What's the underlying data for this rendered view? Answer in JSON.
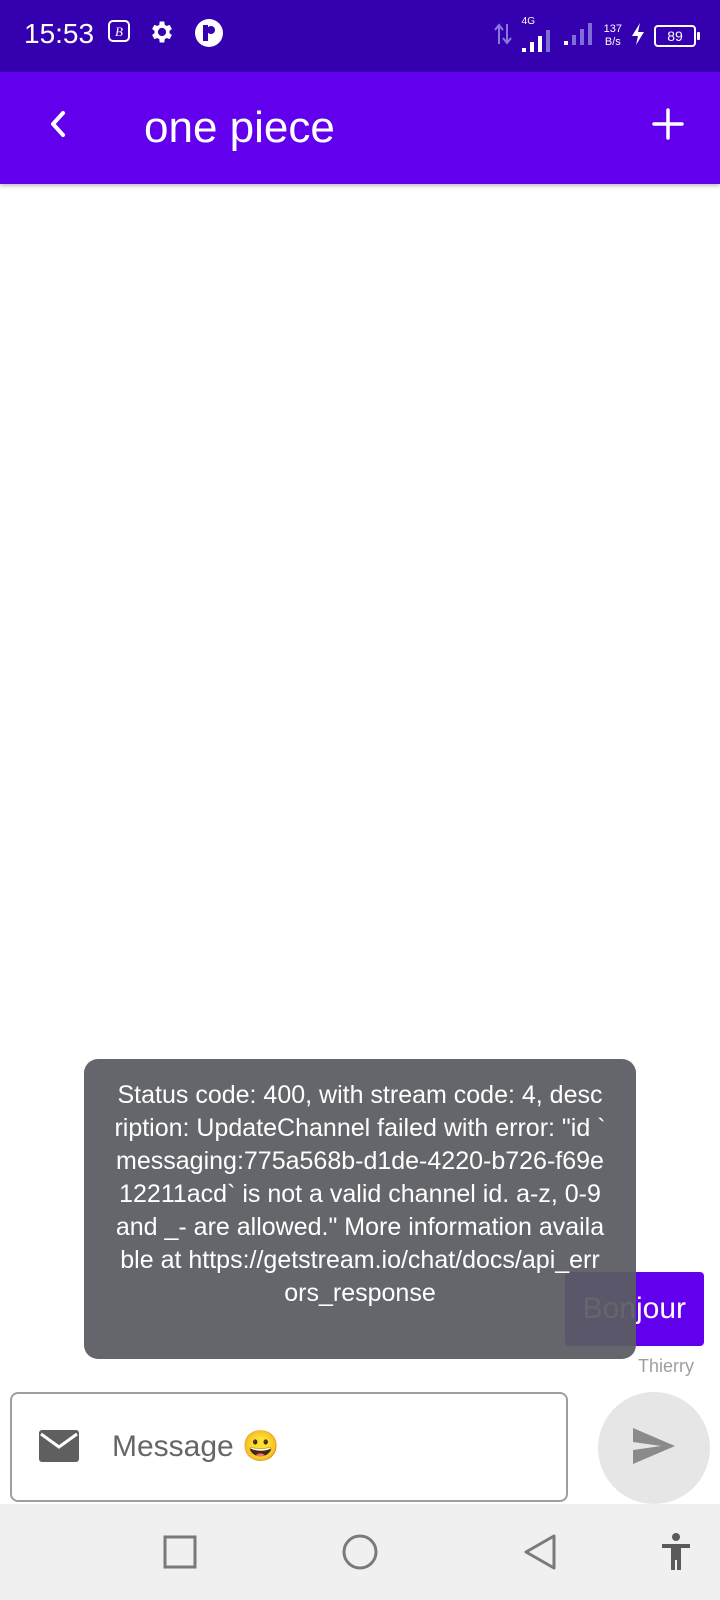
{
  "status_bar": {
    "time": "15:53",
    "network_type": "4G",
    "net_speed_value": "137",
    "net_speed_unit": "B/s",
    "battery": "89",
    "icons": [
      "b-app-icon",
      "gear-icon",
      "p-app-icon",
      "data-arrows-icon",
      "signal-icon",
      "signal-icon-2",
      "charging-icon"
    ]
  },
  "app_bar": {
    "title": "one piece",
    "back_icon": "chevron-left-icon",
    "add_icon": "plus-icon",
    "background": "#6200ee"
  },
  "messages": [
    {
      "text": "Bonjour",
      "sender": "Thierry"
    }
  ],
  "toast": {
    "text": "Status code: 400, with stream code: 4, description: UpdateChannel failed with error: \"id `messaging:775a568b-d1de-4220-b726-f69e12211acd` is not a valid channel id. a-z, 0-9 and _- are allowed.\" More information available at https://getstream.io/chat/docs/api_errors_response"
  },
  "composer": {
    "placeholder": "Message 😀",
    "mail_icon": "mail-icon",
    "send_icon": "send-icon"
  },
  "nav_bar": {
    "icons": [
      "recents-square-icon",
      "home-circle-icon",
      "back-triangle-icon",
      "accessibility-icon"
    ]
  },
  "colors": {
    "status_bar": "#3500b0",
    "accent": "#6200ee",
    "toast": "#5a5c62",
    "send_bg": "#e6e6e6"
  }
}
